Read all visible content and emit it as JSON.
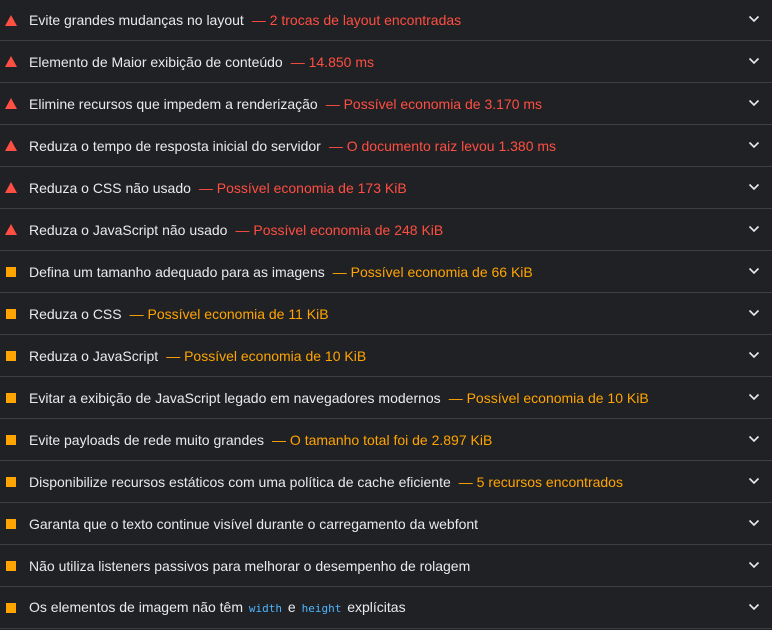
{
  "colors": {
    "background": "#202124",
    "fail": "#ff4e42",
    "average": "#ffa400",
    "text": "#e8eaed",
    "code": "#4db6ff",
    "divider": "#3c4043"
  },
  "audits": [
    {
      "status": "fail",
      "icon": "warning-triangle-icon",
      "title": "Evite grandes mudanças no layout",
      "display": "— 2 trocas de layout encontradas"
    },
    {
      "status": "fail",
      "icon": "warning-triangle-icon",
      "title": "Elemento de Maior exibição de conteúdo",
      "display": "— 14.850 ms"
    },
    {
      "status": "fail",
      "icon": "warning-triangle-icon",
      "title": "Elimine recursos que impedem a renderização",
      "display": "— Possível economia de 3.170 ms"
    },
    {
      "status": "fail",
      "icon": "warning-triangle-icon",
      "title": "Reduza o tempo de resposta inicial do servidor",
      "display": "— O documento raiz levou 1.380 ms"
    },
    {
      "status": "fail",
      "icon": "warning-triangle-icon",
      "title": "Reduza o CSS não usado",
      "display": "— Possível economia de 173 KiB"
    },
    {
      "status": "fail",
      "icon": "warning-triangle-icon",
      "title": "Reduza o JavaScript não usado",
      "display": "— Possível economia de 248 KiB"
    },
    {
      "status": "avg",
      "icon": "orange-square-icon",
      "title": "Defina um tamanho adequado para as imagens",
      "display": "— Possível economia de 66 KiB"
    },
    {
      "status": "avg",
      "icon": "orange-square-icon",
      "title": "Reduza o CSS",
      "display": "— Possível economia de 11 KiB"
    },
    {
      "status": "avg",
      "icon": "orange-square-icon",
      "title": "Reduza o JavaScript",
      "display": "— Possível economia de 10 KiB"
    },
    {
      "status": "avg",
      "icon": "orange-square-icon",
      "title": "Evitar a exibição de JavaScript legado em navegadores modernos",
      "display": "— Possível economia de 10 KiB"
    },
    {
      "status": "avg",
      "icon": "orange-square-icon",
      "title": "Evite payloads de rede muito grandes",
      "display": "— O tamanho total foi de 2.897 KiB"
    },
    {
      "status": "avg",
      "icon": "orange-square-icon",
      "title": "Disponibilize recursos estáticos com uma política de cache eficiente",
      "display": "— 5 recursos encontrados"
    },
    {
      "status": "avg",
      "icon": "orange-square-icon",
      "title": "Garanta que o texto continue visível durante o carregamento da webfont",
      "display": ""
    },
    {
      "status": "avg",
      "icon": "orange-square-icon",
      "title": "Não utiliza listeners passivos para melhorar o desempenho de rolagem",
      "display": ""
    }
  ],
  "last_audit": {
    "status": "avg",
    "icon": "orange-square-icon",
    "title_prefix": "Os elementos de imagem não têm",
    "code_width": "width",
    "conjunction": "e",
    "code_height": "height",
    "title_suffix": "explícitas"
  }
}
